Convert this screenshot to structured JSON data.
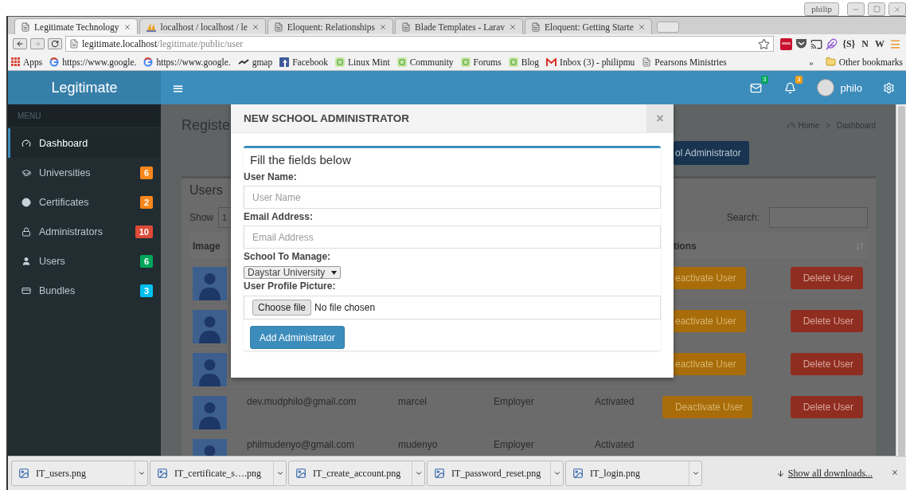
{
  "browser": {
    "window_user": "philip",
    "tabs": [
      {
        "title": "Legitimate Technology",
        "kind": "page",
        "selected": true
      },
      {
        "title": "localhost / localhost / le",
        "kind": "pma",
        "selected": false
      },
      {
        "title": "Eloquent: Relationships",
        "kind": "page",
        "selected": false
      },
      {
        "title": "Blade Templates - Larav",
        "kind": "page",
        "selected": false
      },
      {
        "title": "Eloquent: Getting Starte",
        "kind": "page",
        "selected": false
      }
    ],
    "address": "**legitimate.localhost**/legitimate/public/user",
    "extension_labels": [
      "{S}",
      "N",
      "W"
    ],
    "bookmarks": [
      {
        "label": "Apps",
        "kind": "apps"
      },
      {
        "label": "https://www.google.",
        "kind": "google"
      },
      {
        "label": "https://www.google.",
        "kind": "google"
      },
      {
        "label": "gmap",
        "kind": "gmap"
      },
      {
        "label": "Facebook",
        "kind": "facebook"
      },
      {
        "label": "Linux Mint",
        "kind": "mint"
      },
      {
        "label": "Community",
        "kind": "mint"
      },
      {
        "label": "Forums",
        "kind": "mint"
      },
      {
        "label": "Blog",
        "kind": "mint"
      },
      {
        "label": "Inbox (3) - philipmu",
        "kind": "gmail"
      },
      {
        "label": "Pearsons Ministries",
        "kind": "page"
      }
    ],
    "overflow": "»",
    "other_bookmarks": "Other bookmarks"
  },
  "app": {
    "brand": "Legitimate",
    "menu_toggle": "≡",
    "mail_count": "3",
    "notification_count": "3",
    "user": "philo",
    "sidebar": {
      "heading": "MENU",
      "items": [
        {
          "label": "Dashboard",
          "kind": "dashboard",
          "selected": true
        },
        {
          "label": "Universities",
          "kind": "cap",
          "count": "6",
          "color": "#f7861b",
          "selected": false
        },
        {
          "label": "Certificates",
          "kind": "certificate",
          "count": "2",
          "color": "#f7861b",
          "selected": false
        },
        {
          "label": "Administrators",
          "kind": "lock",
          "count": "10",
          "color": "#dd4b39",
          "selected": false
        },
        {
          "label": "Users",
          "kind": "user",
          "count": "6",
          "color": "#00a65a",
          "selected": false
        },
        {
          "label": "Bundles",
          "kind": "card",
          "count": "3",
          "color": "#00c0ef",
          "selected": false
        }
      ]
    },
    "page": {
      "title": "Registe",
      "add_button": "ol Administrator",
      "breadcrumb": [
        "Home",
        ">",
        "Dashboard"
      ],
      "box_title": "Users",
      "show_label": "Show",
      "show_value": "1",
      "search_label": "Search:",
      "columns": [
        "Image",
        "tions"
      ],
      "rows": [
        {
          "actions": [
            {
              "kind": "deactivate",
              "label": "eactivate User"
            },
            {
              "kind": "delete",
              "label": "Delete User"
            }
          ]
        },
        {
          "actions": [
            {
              "kind": "deactivate",
              "label": "eactivate User"
            },
            {
              "kind": "delete",
              "label": "Delete User"
            }
          ]
        },
        {
          "actions": [
            {
              "kind": "deactivate",
              "label": "eactivate User"
            },
            {
              "kind": "delete",
              "label": "Delete User"
            }
          ]
        },
        {
          "email": "dev.mudphilo@gmail.com",
          "name": "marcel",
          "role": "Employer",
          "status": "Activated",
          "actions": [
            {
              "kind": "deactivate",
              "label": "Deactivate User"
            },
            {
              "kind": "delete",
              "label": "Delete User"
            }
          ]
        },
        {
          "email": "philmudenyo@gmail.com",
          "name": "mudenyo",
          "role": "Employer",
          "status": "Activated"
        }
      ]
    },
    "modal": {
      "title": "NEW SCHOOL ADMINISTRATOR",
      "close": "×",
      "heading": "Fill the fields below",
      "fields": [
        {
          "kind": "text",
          "label": "User Name:",
          "placeholder": "User Name"
        },
        {
          "kind": "text",
          "label": "Email Address:",
          "placeholder": "Email Address"
        },
        {
          "kind": "select",
          "label": "School To Manage:",
          "value": "Daystar University"
        },
        {
          "kind": "file",
          "label": "User Profile Picture:",
          "button": "Choose file",
          "status": "No file chosen"
        }
      ],
      "submit": "Add Administrator"
    }
  },
  "downloads": {
    "files": [
      "IT_users.png",
      "IT_certificate_s….png",
      "IT_create_account.png",
      "IT_password_reset.png",
      "IT_login.png"
    ],
    "show_all": "Show all downloads...",
    "close": "×"
  }
}
